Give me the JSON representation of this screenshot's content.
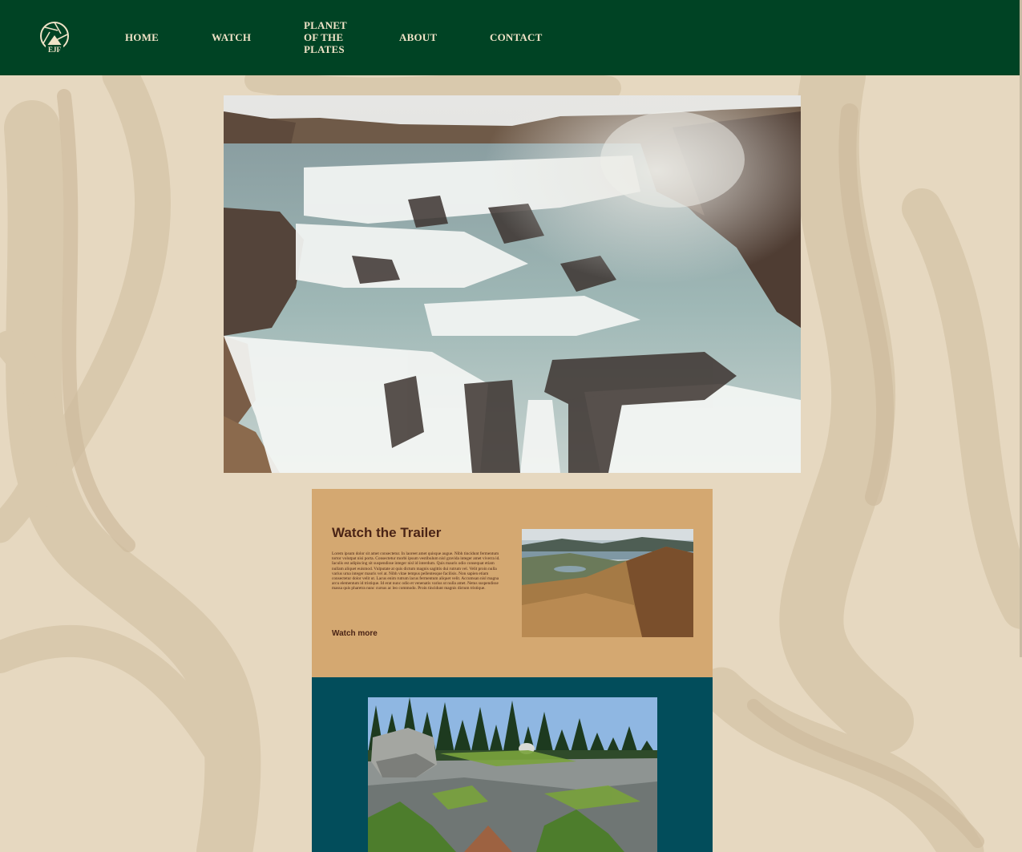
{
  "nav": {
    "logo_icon": "aperture-mountain-logo-icon",
    "logo_text": "EJF",
    "items": [
      {
        "label": "HOME"
      },
      {
        "label": "WATCH"
      },
      {
        "label": "PLANET\nOF THE\nPLATES"
      },
      {
        "label": "ABOUT"
      },
      {
        "label": "CONTACT"
      }
    ]
  },
  "hero": {
    "image": "waterfall-canyon-photo"
  },
  "trailer": {
    "title": "Watch the Trailer",
    "body": "Lorem ipsum dolor sit amet consectetur. In laoreet amet quisque augue. Nibh tincidunt fermentum tortor volutpat nisi porta. Consectetur morbi ipsum vestibulum nisl gravida integer amet viverra id. Iaculis est adipiscing sit suspendisse integer nisl id interdum. Quis mauris odio consequat etiam nullam aliquet euismod. Vulputate at quis dictum magnis sagittis dui rutrum vel. Velit proin nulla varius urna integer mauris vel at. Nibh vitae tempus pellentesque facilisis. Non sapien etiam consectetur dolor velit ut. Lacus enim rutrum lacus fermentum aliquet velit. Accumsan nisl magna arcu elementum id tristique. Id erat nunc odio et venenatis varius ut nulla amet. Netus suspendisse massa quis pharetra nunc cursus ac leo commodo. Proin tincidunt magnis dictum tristique.",
    "link": "Watch more",
    "image": "tundra-hills-photo"
  },
  "feature": {
    "image": "forest-boulder-photo"
  },
  "colors": {
    "nav_bg": "#004324",
    "page_bg": "#e6d8c0",
    "trailer_bg": "#d4a871",
    "teal_bg": "#024d5b",
    "text_brown": "#4a2416",
    "nav_text": "#f0e3c7"
  }
}
